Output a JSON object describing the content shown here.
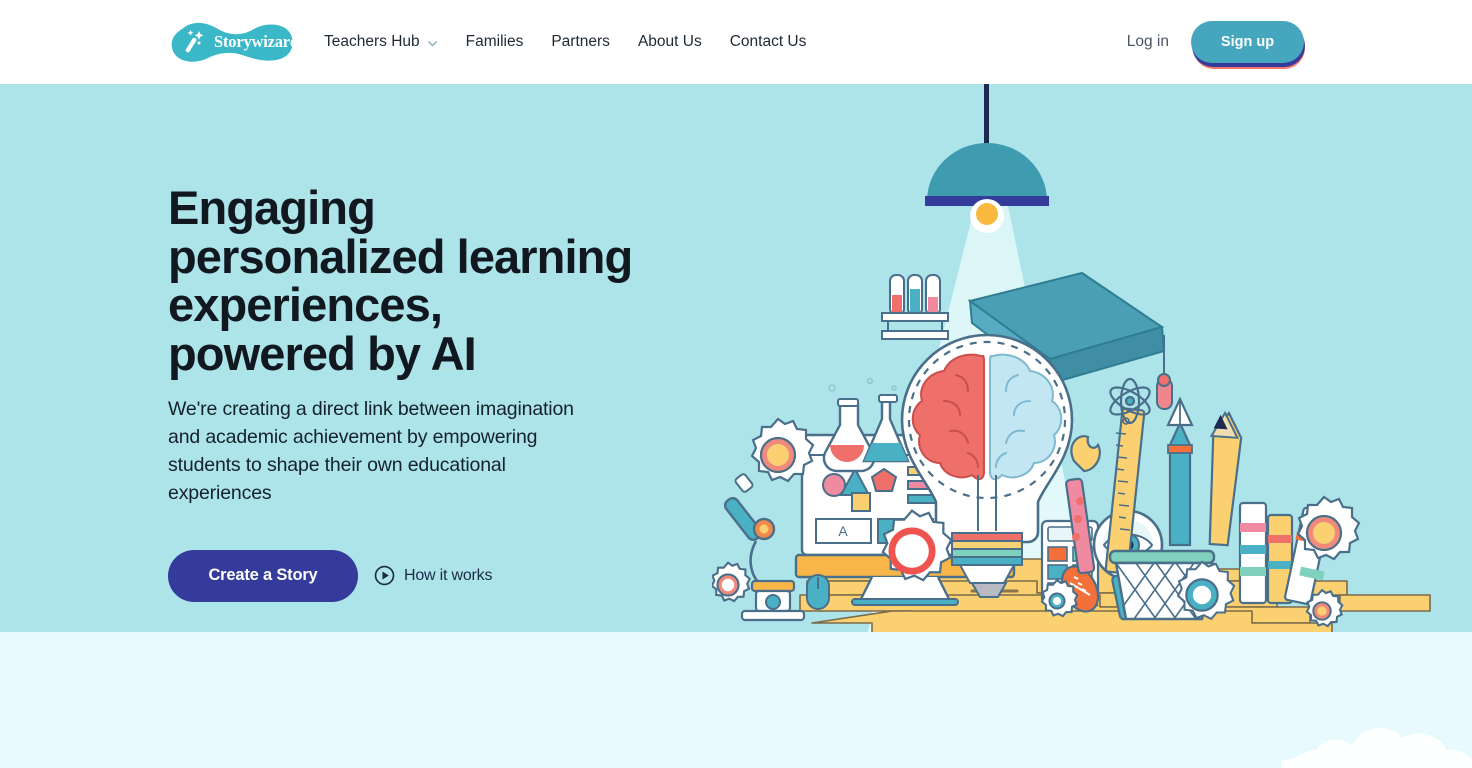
{
  "header": {
    "logo": {
      "name": "Storywizard.ai",
      "icon": "magic-wand-icon",
      "blob_color": "#3ab8c8"
    },
    "nav": [
      {
        "label": "Teachers Hub",
        "has_dropdown": true,
        "icon": "chevron-down-icon"
      },
      {
        "label": "Families",
        "has_dropdown": false
      },
      {
        "label": "Partners",
        "has_dropdown": false
      },
      {
        "label": "About Us",
        "has_dropdown": false
      },
      {
        "label": "Contact Us",
        "has_dropdown": false
      }
    ],
    "login_label": "Log in",
    "signup_label": "Sign up",
    "signup_color": "#46a6bd",
    "signup_shadow_color": "#f2786e"
  },
  "hero": {
    "title": "Engaging personalized learning experiences, powered by AI",
    "subtitle": "We're creating a direct link between imagination and academic achievement by empowering students to shape their own educational experiences",
    "cta_label": "Create a Story",
    "cta_color": "#343b9a",
    "how_it_works_label": "How it works",
    "how_it_works_icon": "play-circle-icon",
    "background_color": "#ace4e9",
    "illustration": "education-tools-lightbulb-brain-illustration"
  },
  "lower_section": {
    "background_color": "#e8fafd",
    "decoration": "cloud-shape"
  }
}
